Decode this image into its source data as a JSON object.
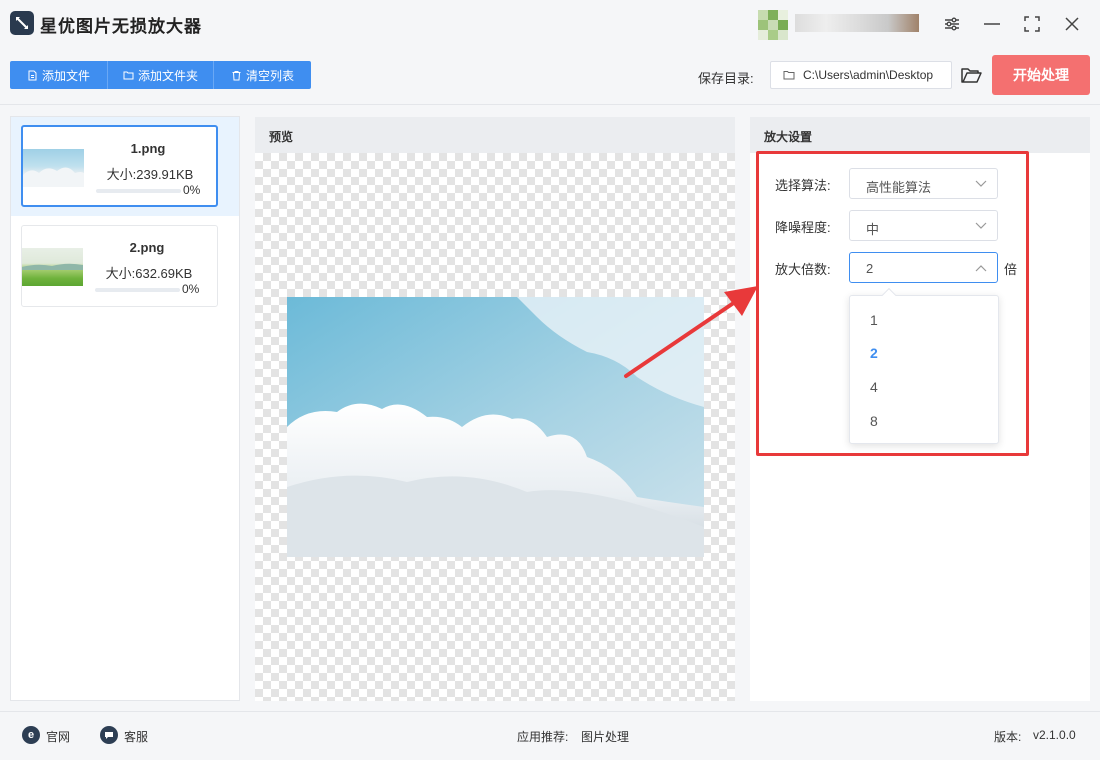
{
  "app": {
    "title": "星优图片无损放大器"
  },
  "toolbar": {
    "add_file": "添加文件",
    "add_folder": "添加文件夹",
    "clear_list": "清空列表",
    "save_dir_label": "保存目录:",
    "save_dir_value": "C:\\Users\\admin\\Desktop",
    "start": "开始处理"
  },
  "files": [
    {
      "name": "1.png",
      "size": "大小:239.91KB",
      "progress_label": "0%",
      "progress": 0
    },
    {
      "name": "2.png",
      "size": "大小:632.69KB",
      "progress_label": "0%",
      "progress": 0
    }
  ],
  "preview": {
    "title": "预览"
  },
  "settings": {
    "title": "放大设置",
    "algorithm_label": "选择算法:",
    "algorithm_value": "高性能算法",
    "denoise_label": "降噪程度:",
    "denoise_value": "中",
    "scale_label": "放大倍数:",
    "scale_value": "2",
    "scale_unit": "倍",
    "scale_options": [
      "1",
      "2",
      "4",
      "8"
    ]
  },
  "status": {
    "website": "官网",
    "support": "客服",
    "recommend_label": "应用推荐:",
    "recommend_value": "图片处理",
    "version_label": "版本:",
    "version_value": "v2.1.0.0"
  },
  "colors": {
    "accent": "#3f8ef0",
    "start_button": "#f47070",
    "highlight": "#e8393a"
  }
}
